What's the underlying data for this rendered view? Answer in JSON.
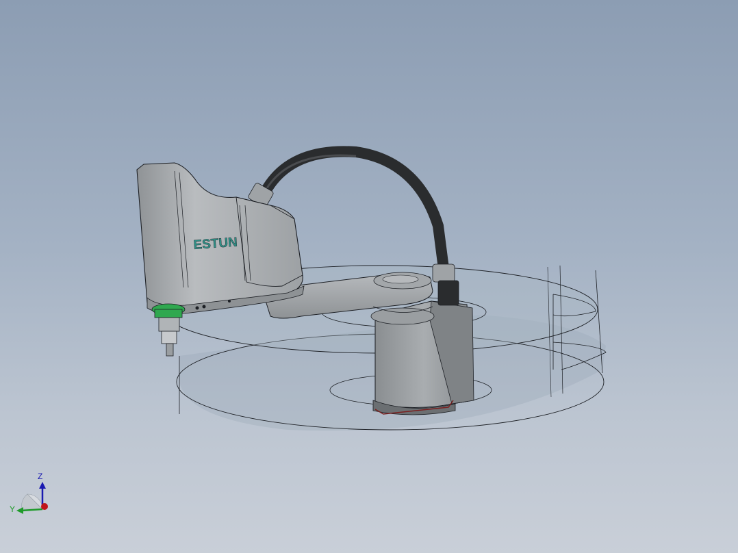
{
  "viewport": {
    "background_top": "#8c9db3",
    "background_bottom": "#c9cfd8"
  },
  "model": {
    "brand_label": "ESTUN",
    "body_color": "#a8acaf",
    "cable_color": "#2a2c2e",
    "accent_green": "#2fa84f",
    "brand_text_color": "#2f8f86",
    "workspace_color": "#9aa8b8"
  },
  "triad": {
    "z_label": "Z",
    "y_label": "Y",
    "z_color": "#1a1ab0",
    "y_color": "#1f9a2a",
    "x_color": "#c0141a"
  }
}
